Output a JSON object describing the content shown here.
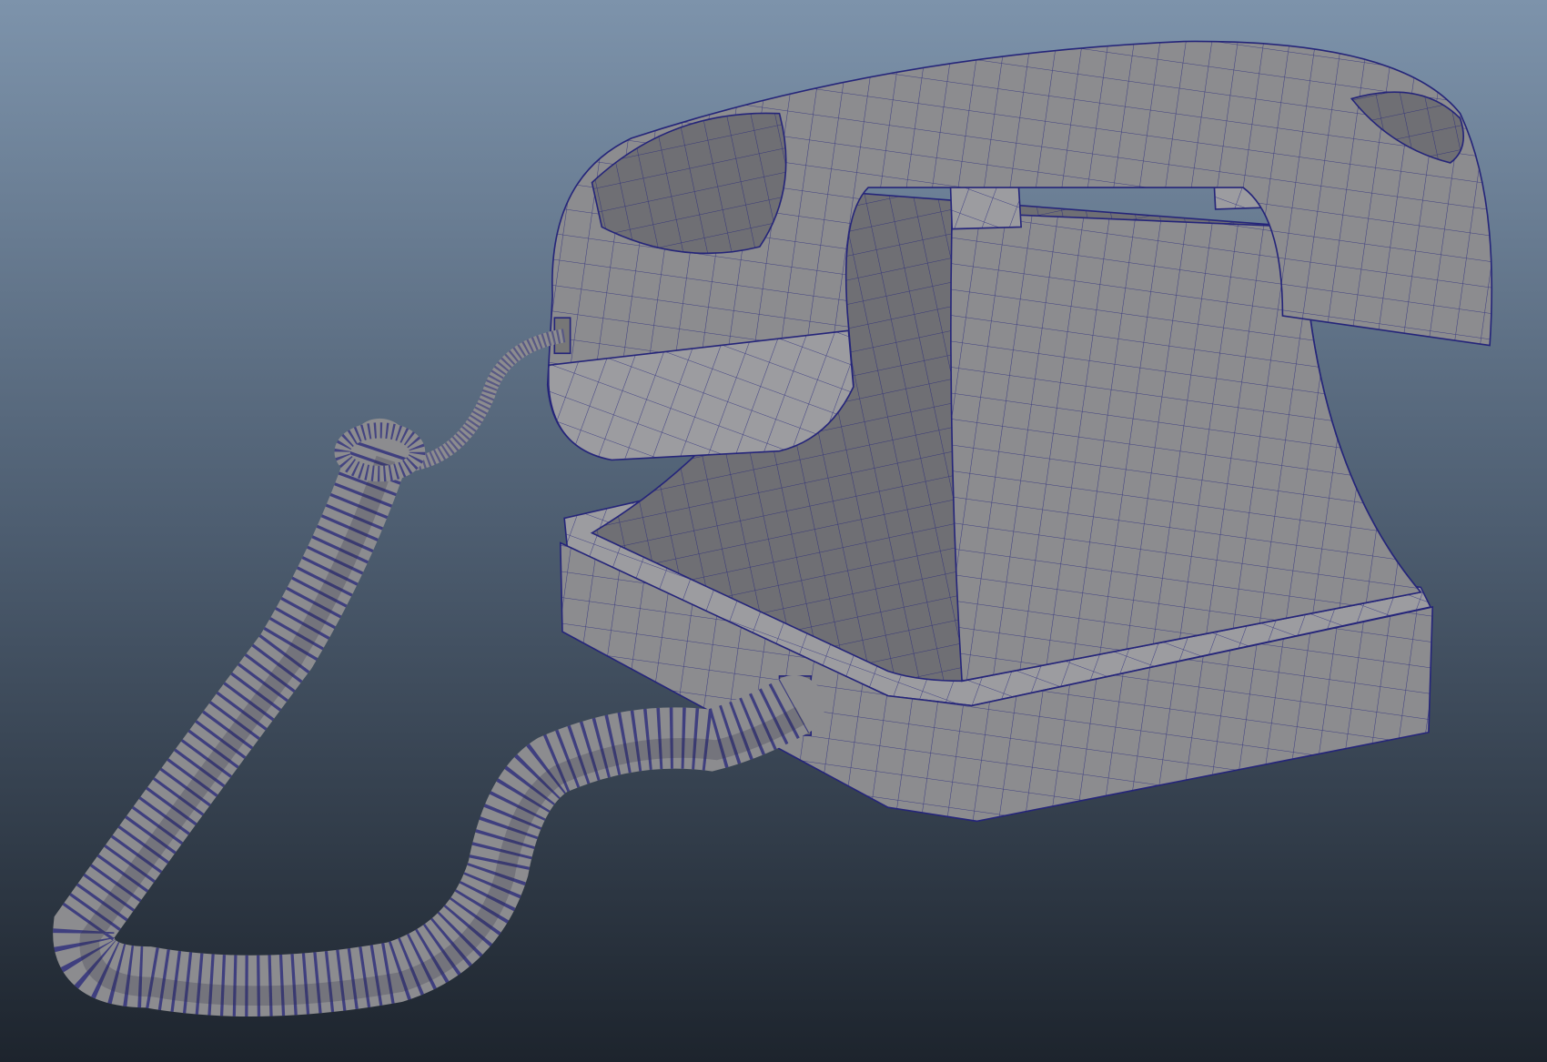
{
  "scene": {
    "colors": {
      "background_top": "#7d93ab",
      "background_mid": "#4d5d70",
      "background_bottom": "#1d242d",
      "mesh_surface": "#8c8c8f",
      "mesh_shadow": "#5e5e62",
      "mesh_highlight": "#a4a4a8",
      "wire": "#25257a"
    }
  }
}
